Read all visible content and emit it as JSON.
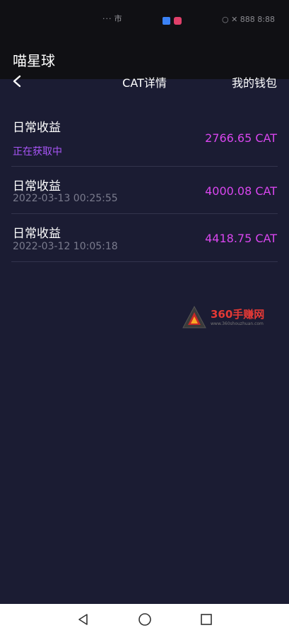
{
  "status_bar": {
    "left_text": "··· 市",
    "right_text": "○ ✕ 888 8:88"
  },
  "app": {
    "title": "喵星球"
  },
  "nav": {
    "title": "CAT详情",
    "action": "我的钱包"
  },
  "records": [
    {
      "label": "日常收益",
      "sub": "正在获取中",
      "amount": "2766.65 CAT"
    },
    {
      "label": "日常收益",
      "sub": "2022-03-13 00:25:55",
      "amount": "4000.08 CAT"
    },
    {
      "label": "日常收益",
      "sub": "2022-03-12 10:05:18",
      "amount": "4418.75 CAT"
    }
  ],
  "watermark": {
    "text": "360手赚网",
    "url": "www.360shouzhuan.com"
  },
  "colors": {
    "background": "#1b1c33",
    "amount": "#d946ef",
    "pending": "#a855f7"
  }
}
